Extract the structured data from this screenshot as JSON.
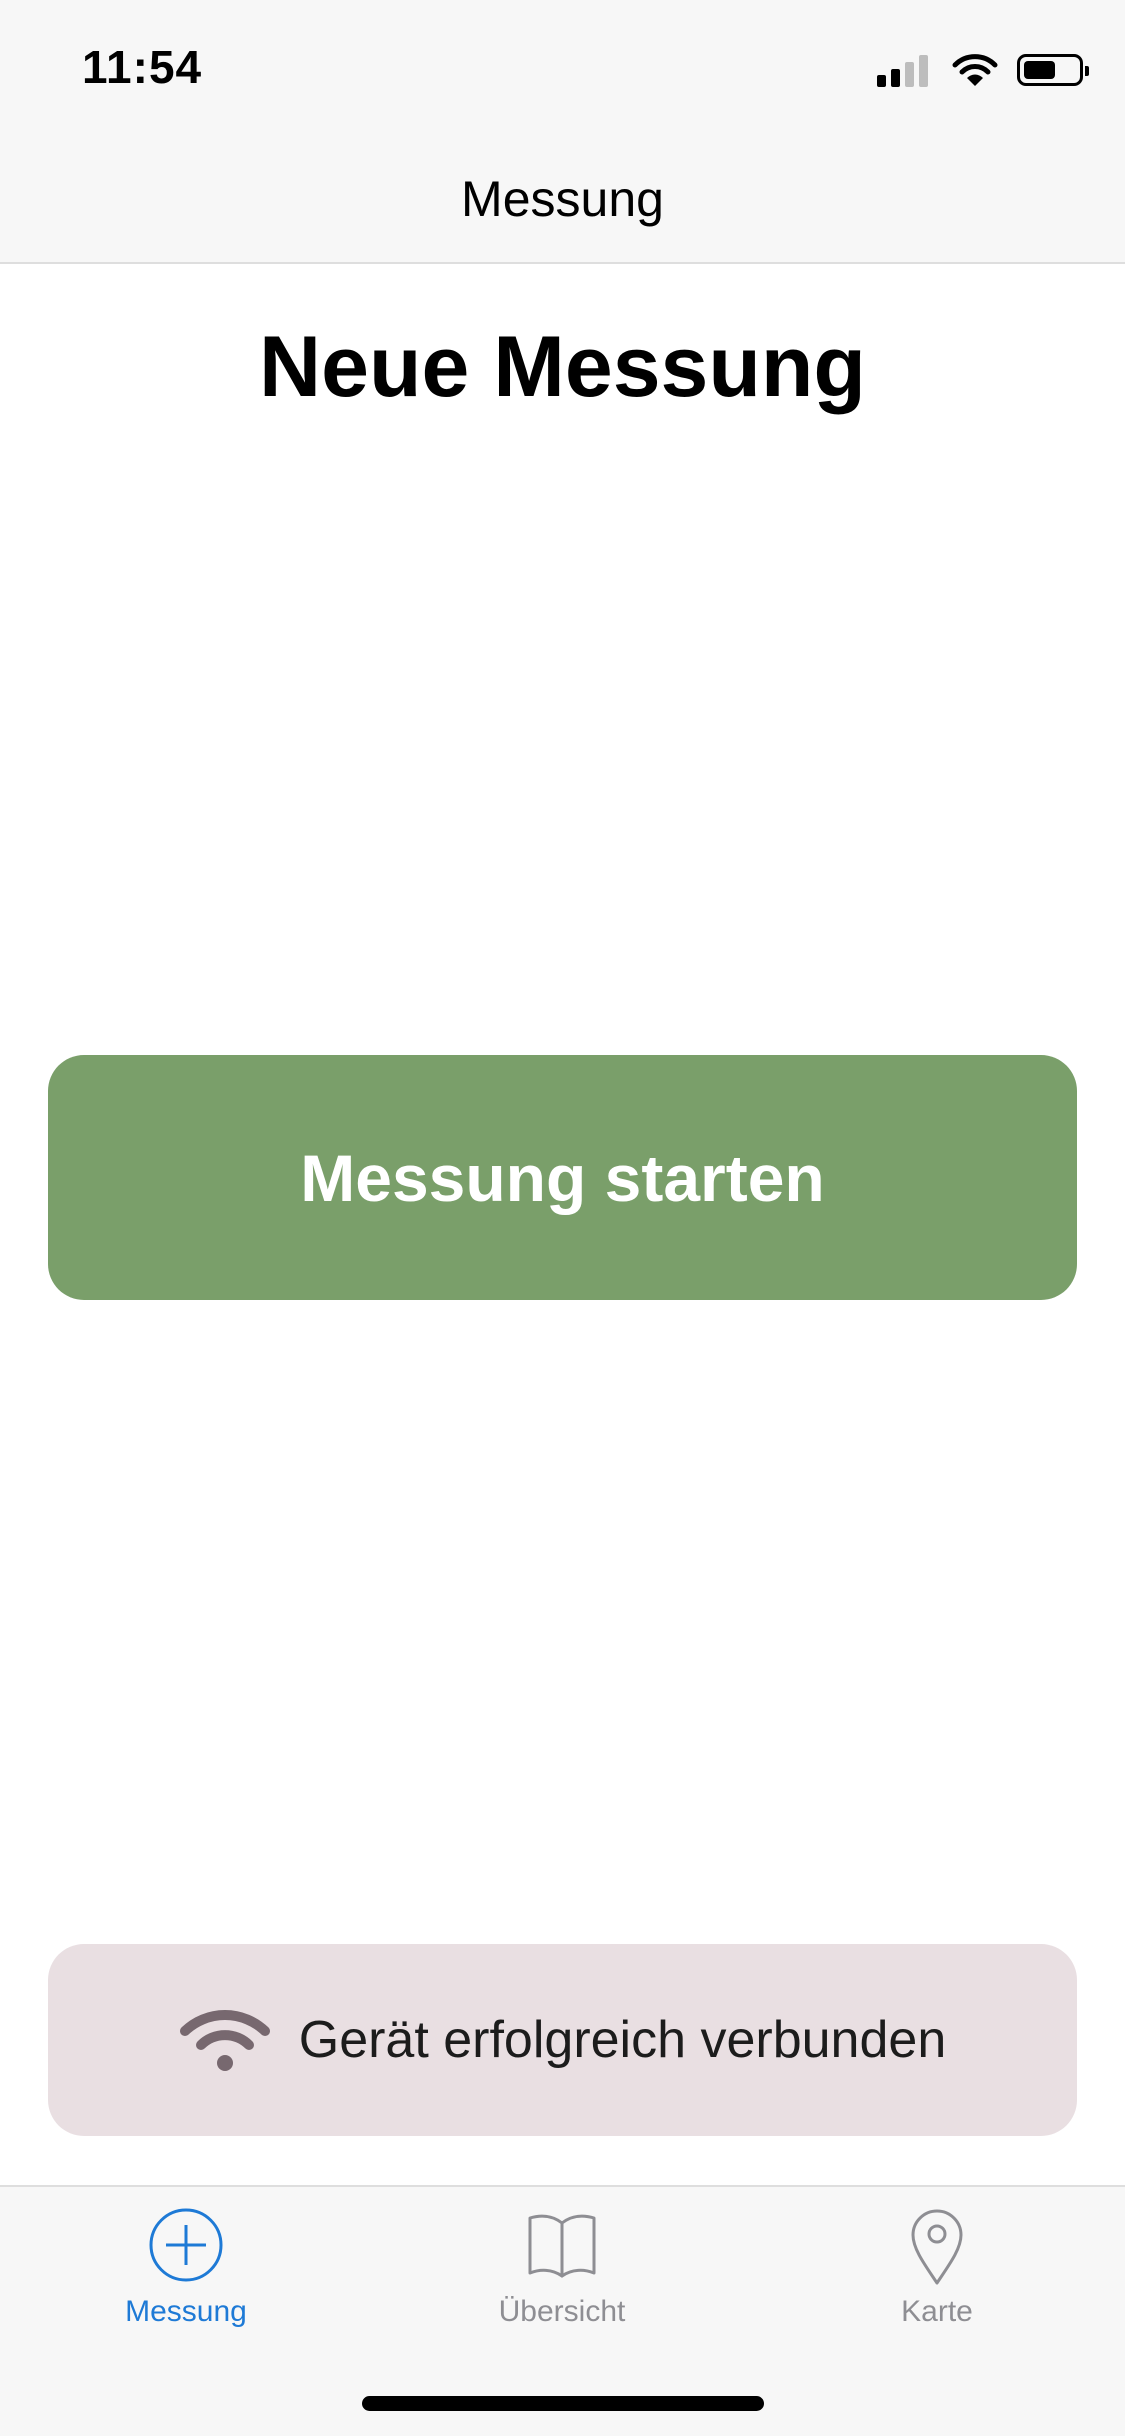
{
  "status_bar": {
    "time": "11:54",
    "icons": [
      "cellular-signal-icon",
      "wifi-icon",
      "battery-icon"
    ],
    "signal_bars_active": 2,
    "signal_bars_total": 4,
    "battery_level": 0.6
  },
  "nav_bar": {
    "title": "Messung"
  },
  "page": {
    "title": "Neue Messung"
  },
  "start_button": {
    "label": "Messung starten",
    "color": "#7a9f6a"
  },
  "connection_banner": {
    "icon": "wifi-icon",
    "text": "Gerät erfolgreich verbunden",
    "background": "#e9dfe2",
    "icon_color": "#77686f"
  },
  "tab_bar": {
    "active_color": "#1e7ad6",
    "inactive_color": "#8e8e93",
    "tabs": [
      {
        "label": "Messung",
        "icon": "plus-circle-icon",
        "active": true
      },
      {
        "label": "Übersicht",
        "icon": "book-icon",
        "active": false
      },
      {
        "label": "Karte",
        "icon": "map-pin-icon",
        "active": false
      }
    ]
  }
}
